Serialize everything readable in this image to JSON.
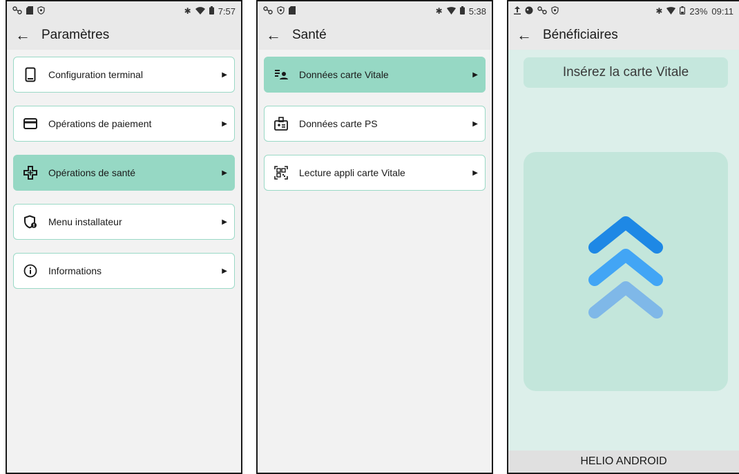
{
  "screens": [
    {
      "status": {
        "time": "7:57",
        "left_icons": [
          "link-icon",
          "sd-card-icon",
          "shield-icon"
        ],
        "right_icons": [
          "bluetooth-icon",
          "wifi-icon",
          "battery-icon"
        ]
      },
      "title": "Paramètres",
      "items": [
        {
          "label": "Configuration terminal",
          "icon": "terminal-icon",
          "active": false
        },
        {
          "label": "Opérations de paiement",
          "icon": "credit-card-icon",
          "active": false
        },
        {
          "label": "Opérations de santé",
          "icon": "health-cross-icon",
          "active": true
        },
        {
          "label": "Menu installateur",
          "icon": "installer-shield-icon",
          "active": false
        },
        {
          "label": "Informations",
          "icon": "info-icon",
          "active": false
        }
      ]
    },
    {
      "status": {
        "time": "5:38",
        "left_icons": [
          "link-icon",
          "shield-icon",
          "sd-card-icon"
        ],
        "right_icons": [
          "bluetooth-icon",
          "signal-icon",
          "battery-icon"
        ]
      },
      "title": "Santé",
      "items": [
        {
          "label": "Données carte Vitale",
          "icon": "patient-card-icon",
          "active": true
        },
        {
          "label": "Données carte PS",
          "icon": "medical-badge-icon",
          "active": false
        },
        {
          "label": "Lecture appli carte Vitale",
          "icon": "qr-scan-icon",
          "active": false
        }
      ]
    },
    {
      "status": {
        "time": "09:11",
        "battery": "23%",
        "left_icons": [
          "upload-icon",
          "app-icon",
          "link-icon",
          "shield-icon"
        ],
        "right_icons": [
          "bluetooth-icon",
          "signal-icon",
          "battery-icon"
        ]
      },
      "title": "Bénéficiaires",
      "instruction": "Insérez la carte Vitale",
      "graphic": "insert-card-chevrons-icon",
      "footer": "HELIO ANDROID"
    }
  ],
  "colors": {
    "accent": "#96d8c4",
    "border": "#9ad9c6",
    "chevron_top": "#1e88e5",
    "chevron_mid": "#42a5f5",
    "chevron_bottom": "#7fb8e8"
  }
}
